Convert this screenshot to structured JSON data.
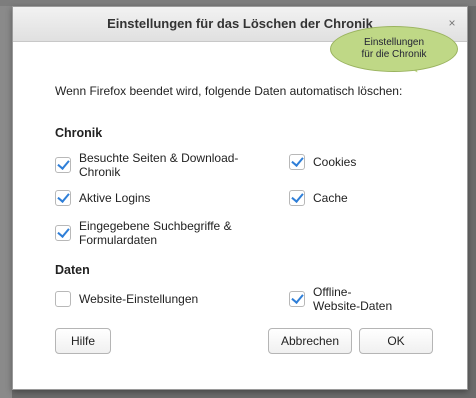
{
  "dialog": {
    "title": "Einstellungen für das Löschen der Chronik",
    "close_glyph": "×"
  },
  "callout": {
    "line1": "Einstellungen",
    "line2": "für die Chronik"
  },
  "intro": "Wenn Firefox beendet wird, folgende Daten automatisch löschen:",
  "chronik": {
    "heading": "Chronik",
    "items": [
      {
        "label_line1": "Besuchte Seiten & Download-",
        "label_line2": "Chronik",
        "checked": true
      },
      {
        "label_line1": "Cookies",
        "label_line2": "",
        "checked": true
      },
      {
        "label_line1": "Aktive Logins",
        "label_line2": "",
        "checked": true
      },
      {
        "label_line1": "Cache",
        "label_line2": "",
        "checked": true
      },
      {
        "label_line1": "Eingegebene Suchbegriffe &",
        "label_line2": "Formulardaten",
        "checked": true
      }
    ]
  },
  "daten": {
    "heading": "Daten",
    "items": [
      {
        "label_line1": "Website-Einstellungen",
        "label_line2": "",
        "checked": false
      },
      {
        "label_line1": "Offline-",
        "label_line2": "Website-Daten",
        "checked": true
      }
    ]
  },
  "buttons": {
    "help": "Hilfe",
    "cancel": "Abbrechen",
    "ok": "OK"
  },
  "colors": {
    "checkmark": "#2f7fd8",
    "callout": "#bfd886"
  }
}
